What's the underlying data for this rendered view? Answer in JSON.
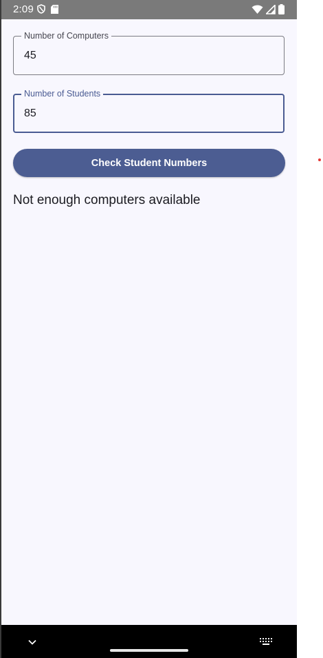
{
  "status_bar": {
    "time": "2:09",
    "left_icons": [
      "vpn-shield-icon",
      "sd-card-icon"
    ],
    "right_icons": [
      "wifi-icon",
      "cell-signal-icon",
      "battery-icon"
    ]
  },
  "form": {
    "computers": {
      "label": "Number of Computers",
      "value": "45"
    },
    "students": {
      "label": "Number of Students",
      "value": "85"
    },
    "check_button_label": "Check Student Numbers"
  },
  "result": {
    "message": "Not enough computers available"
  },
  "nav_bar": {
    "icons": [
      "chevron-down-icon",
      "home-handle",
      "keyboard-icon"
    ]
  },
  "colors": {
    "background": "#f8f7fe",
    "status_bar": "#7a7a7a",
    "accent": "#4c5d92",
    "text": "#1b1b21",
    "outline": "#7b7b82"
  }
}
